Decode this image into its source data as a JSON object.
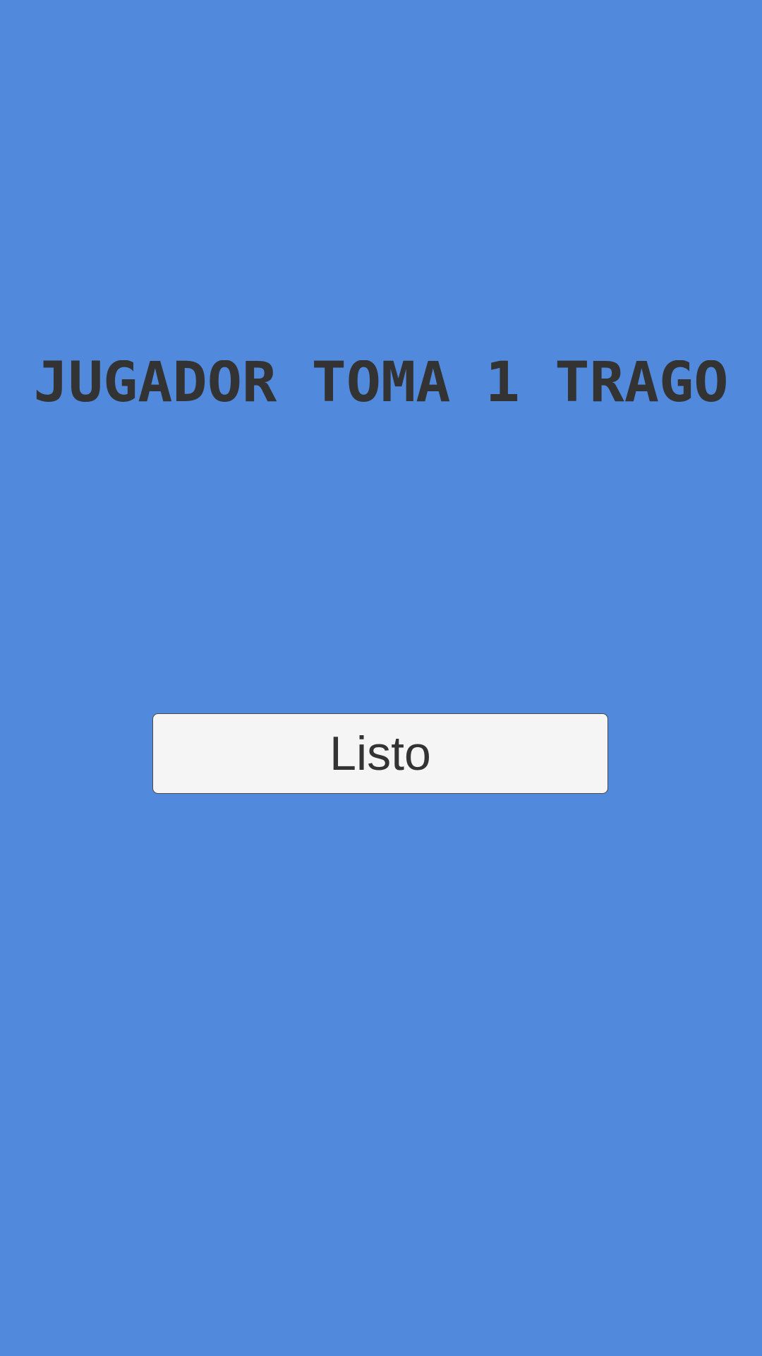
{
  "screen": {
    "title": "JUGADOR TOMA 1 TRAGO",
    "button_label": "Listo"
  },
  "colors": {
    "background": "#5189dc",
    "title_text": "#333333",
    "button_background": "#f5f5f5",
    "button_text": "#333333",
    "button_border": "#4a4a4a"
  }
}
